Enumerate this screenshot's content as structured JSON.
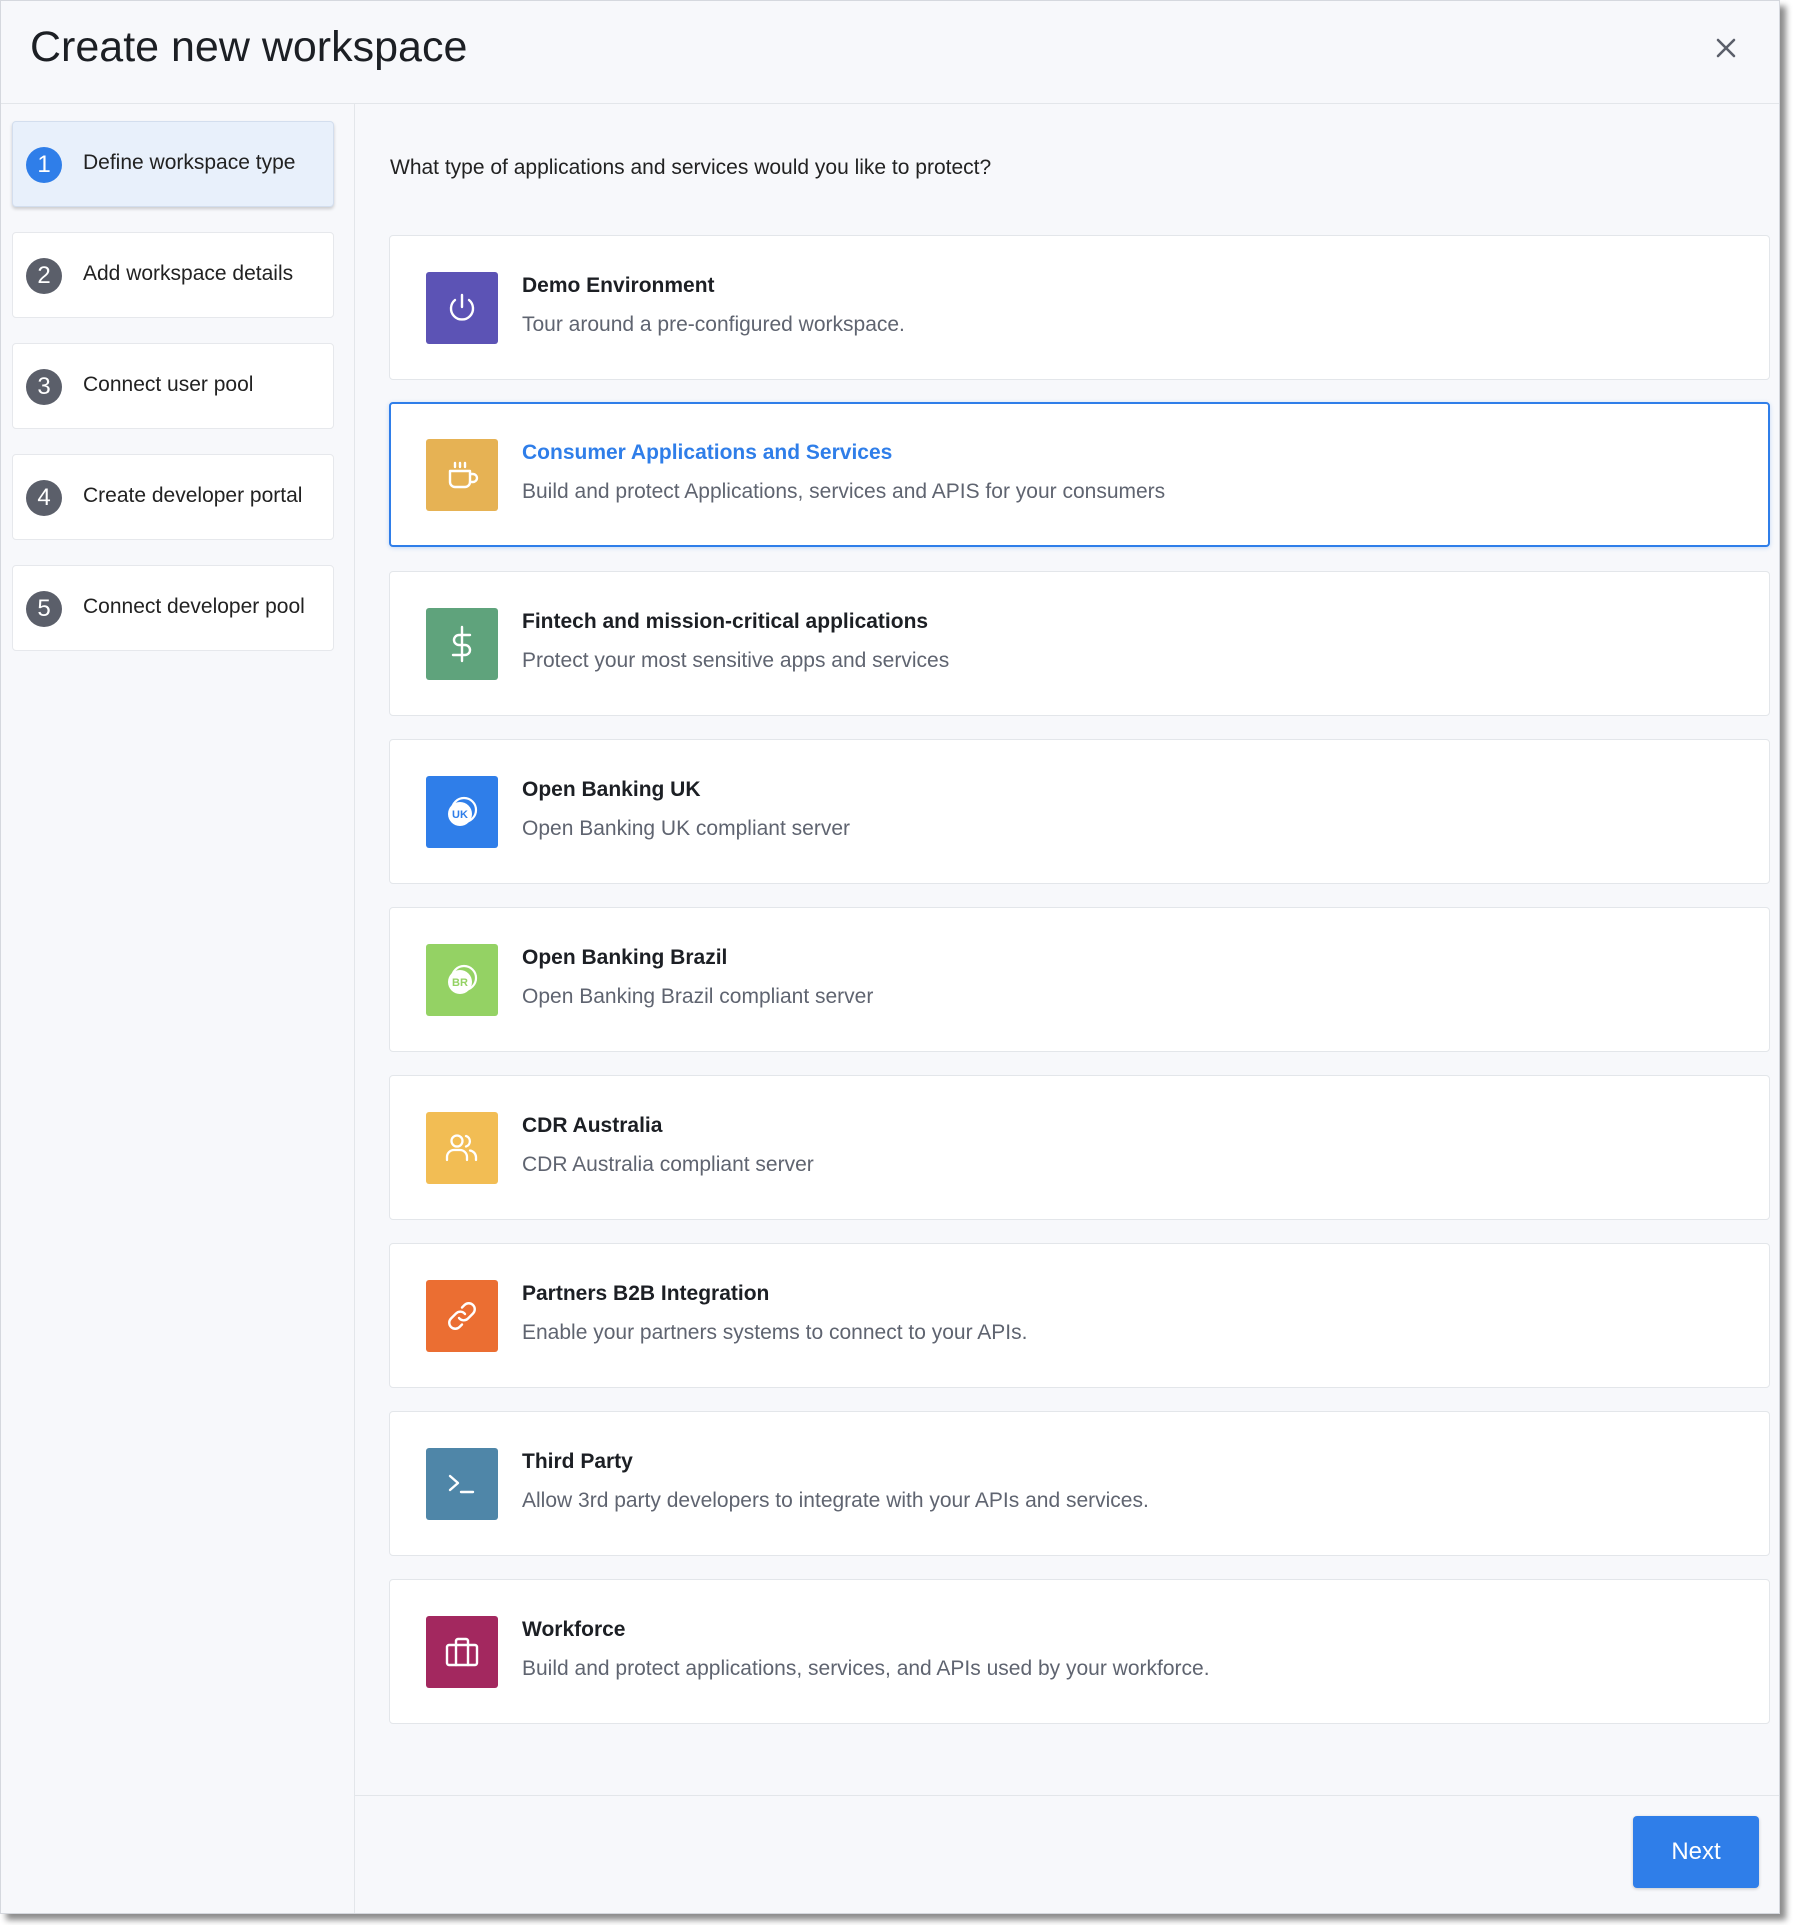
{
  "dialog": {
    "title": "Create new workspace",
    "close_icon": "close-icon"
  },
  "steps": [
    {
      "number": "1",
      "label": "Define workspace type",
      "active": true
    },
    {
      "number": "2",
      "label": "Add workspace details",
      "active": false
    },
    {
      "number": "3",
      "label": "Connect user pool",
      "active": false
    },
    {
      "number": "4",
      "label": "Create developer portal",
      "active": false
    },
    {
      "number": "5",
      "label": "Connect developer pool",
      "active": false
    }
  ],
  "main": {
    "question": "What type of applications and services would you like to protect?"
  },
  "options": [
    {
      "name": "Demo Environment",
      "description": "Tour around a pre-configured workspace.",
      "icon": "power-icon",
      "color": "#5c53b5",
      "selected": false
    },
    {
      "name": "Consumer Applications and Services",
      "description": "Build and protect Applications, services and APIS for your consumers",
      "icon": "coffee-cup-icon",
      "color": "#e6b254",
      "selected": true
    },
    {
      "name": "Fintech and mission-critical applications",
      "description": "Protect your most sensitive apps and services",
      "icon": "dollar-icon",
      "color": "#5fa37c",
      "selected": false
    },
    {
      "name": "Open Banking UK",
      "description": "Open Banking UK compliant server",
      "icon": "uk-badge-icon",
      "badge": "UK",
      "color": "#2f7ee9",
      "selected": false
    },
    {
      "name": "Open Banking Brazil",
      "description": "Open Banking Brazil compliant server",
      "icon": "br-badge-icon",
      "badge": "BR",
      "color": "#94d264",
      "selected": false
    },
    {
      "name": "CDR Australia",
      "description": "CDR Australia compliant server",
      "icon": "users-icon",
      "color": "#f2bd54",
      "selected": false
    },
    {
      "name": "Partners B2B Integration",
      "description": "Enable your partners systems to connect to your APIs.",
      "icon": "link-icon",
      "color": "#eb6e32",
      "selected": false
    },
    {
      "name": "Third Party",
      "description": "Allow 3rd party developers to integrate with your APIs and services.",
      "icon": "terminal-icon",
      "color": "#4f86a8",
      "selected": false
    },
    {
      "name": "Workforce",
      "description": "Build and protect applications, services, and APIs used by your workforce.",
      "icon": "briefcase-icon",
      "color": "#a3285f",
      "selected": false
    }
  ],
  "footer": {
    "next_label": "Next"
  }
}
